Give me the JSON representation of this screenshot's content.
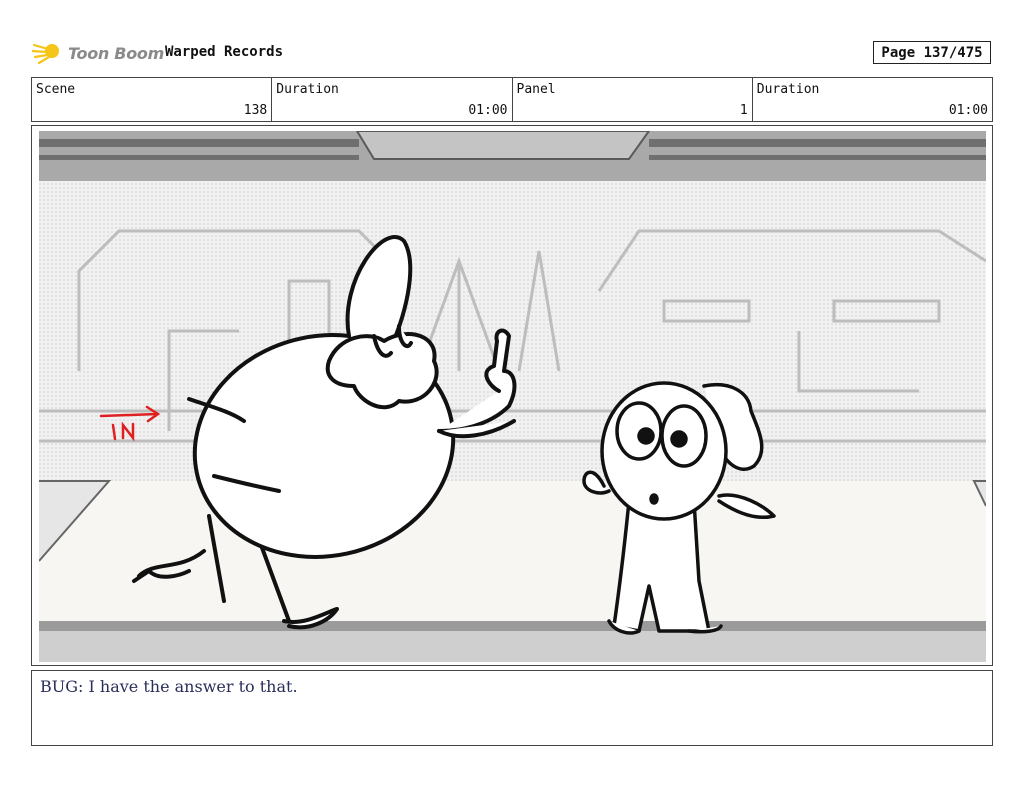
{
  "header": {
    "logo_text": "Toon Boom",
    "project_title": "Warped Records",
    "page_label": "Page 137/475"
  },
  "info": {
    "scene_label": "Scene",
    "scene_value": "138",
    "scene_duration_label": "Duration",
    "scene_duration_value": "01:00",
    "panel_label": "Panel",
    "panel_value": "1",
    "panel_duration_label": "Duration",
    "panel_duration_value": "01:00"
  },
  "panel": {
    "annotation_text": "IN",
    "annotation_color": "#e02020"
  },
  "caption": {
    "dialogue": "BUG: I have the answer to that."
  },
  "colors": {
    "logo_accent": "#f5c518",
    "caption_text": "#2a2e5a"
  }
}
